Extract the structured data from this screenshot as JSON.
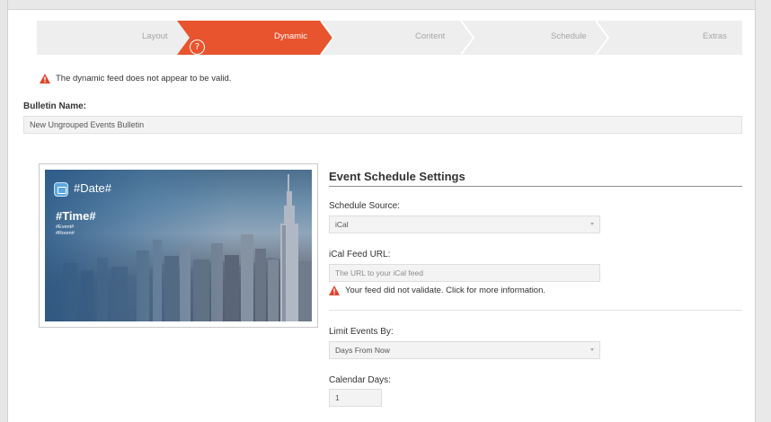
{
  "wizard": {
    "steps": [
      {
        "label": "Layout",
        "active": false
      },
      {
        "label": "Dynamic",
        "active": true
      },
      {
        "label": "Content",
        "active": false
      },
      {
        "label": "Schedule",
        "active": false
      },
      {
        "label": "Extras",
        "active": false
      }
    ],
    "help_glyph": "?",
    "active_color": "#e8542e",
    "inactive_color": "#eeeeee"
  },
  "alert": {
    "message": "The dynamic feed does not appear to be valid.",
    "icon": "warning-triangle-icon",
    "icon_color": "#e0432a"
  },
  "bulletin": {
    "label": "Bulletin Name:",
    "value": "New Ungrouped Events Bulletin"
  },
  "preview": {
    "date": "#Date#",
    "time": "#Time#",
    "event": "#Event#",
    "room": "#Room#"
  },
  "schedule": {
    "title": "Event Schedule Settings",
    "source_label": "Schedule Source:",
    "source_value": "iCal",
    "feed_label": "iCal Feed URL:",
    "feed_placeholder": "The URL to your iCal feed",
    "feed_warning": "Your feed did not validate. Click for more information.",
    "limit_label": "Limit Events By:",
    "limit_value": "Days From Now",
    "days_label": "Calendar Days:",
    "days_value": "1"
  }
}
